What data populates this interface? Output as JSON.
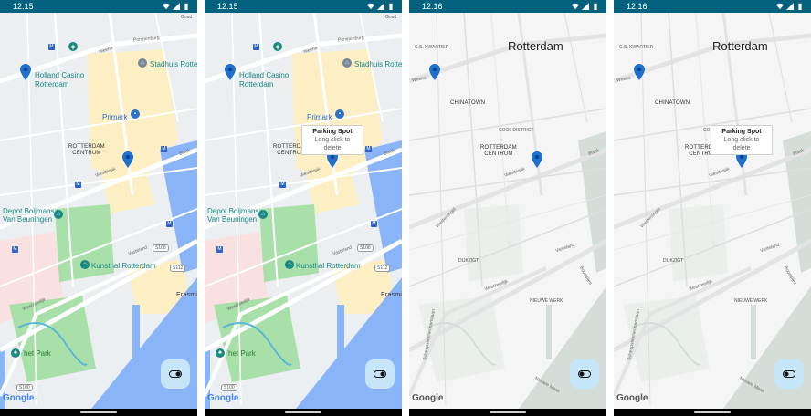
{
  "phones": [
    {
      "time": "12:15",
      "style": "normal",
      "labels": {
        "pompenburg": "Pompenburg",
        "weena": "Weena",
        "holland_casino": "Holland Casino\nRotterdam",
        "stadhuis": "Stadhuis Rotter",
        "primark": "Primark",
        "rotterdam_centrum": "ROTTERDAM\nCENTRUM",
        "westblaak": "Westblaak",
        "blaak": "Blaak",
        "depot": "Depot Boijmans\nVan Beuningen",
        "kunsthal": "Kunsthal Rotterdam",
        "vasteland": "Vasteland",
        "westzeedijk": "Westzeedijk",
        "het_park": "het Park",
        "erasmus": "Erasmi",
        "goud": "Goud",
        "shield_s108": "S108",
        "shield_s112": "S112",
        "shield_s100": "S100"
      }
    },
    {
      "time": "12:15",
      "style": "normal",
      "info_title": "Parking Spot",
      "info_snippet": "Long click to delete",
      "labels": {
        "pompenburg": "Pompenburg",
        "weena": "Weena",
        "holland_casino": "Holland Casino\nRotterdam",
        "stadhuis": "Stadhuis Rotter",
        "primark": "Primark",
        "rotterdam_centrum": "ROTTERDAM\nCENTRUM",
        "westblaak": "Westblaak",
        "blaak": "Blaak",
        "depot": "Depot Boijmans\nVan Beuningen",
        "kunsthal": "Kunsthal Rotterdam",
        "vasteland": "Vasteland",
        "westzeedijk": "Westzeedijk",
        "het_park": "het Park",
        "erasmus": "Erasmi",
        "goud": "Goud",
        "shield_s108": "S108",
        "shield_s112": "S112",
        "shield_s100": "S100"
      }
    },
    {
      "time": "12:16",
      "style": "retro",
      "labels": {
        "cs_kwartier": "C.S. KWARTIER",
        "rotterdam": "Rotterdam",
        "weena": "Weena",
        "chinatown": "CHINATOWN",
        "cool_district": "COOL DISTRICT",
        "rotterdam_centrum": "ROTTERDAM\nCENTRUM",
        "westblaak": "Westblaak",
        "blaak": "Blaak",
        "dijkzigt": "DIJKZIGT",
        "vasteland": "Vasteland",
        "westzeedijk": "Westzeedijk",
        "nieuwe_werk": "NIEUWE WERK",
        "scheepstimmermanslaan": "Scheepstimmermanslaan",
        "boompjes": "Boompjes",
        "westersingel": "Westersingel",
        "nieuwe_maas": "Nieuwe Maas"
      }
    },
    {
      "time": "12:16",
      "style": "retro",
      "info_title": "Parking Spot",
      "info_snippet": "Long click to delete",
      "labels": {
        "cs_kwartier": "C.S. KWARTIER",
        "rotterdam": "Rotterdam",
        "weena": "Weena",
        "chinatown": "CHINATOWN",
        "cool_district": "CO",
        "rotterdam_centrum": "ROTTERDAM\nCENTRUM",
        "westblaak": "Westblaak",
        "blaak": "Blaak",
        "dijkzigt": "DIJKZIGT",
        "vasteland": "Vasteland",
        "westzeedijk": "Westzeedijk",
        "nieuwe_werk": "NIEUWE WERK",
        "scheepstimmermanslaan": "Scheepstimmermanslaan",
        "boompjes": "Boompjes",
        "westersingel": "Westersingel",
        "nieuwe_maas": "Nieuwe Maas"
      }
    }
  ],
  "google_logo": "Google",
  "icons": {
    "status": [
      "wifi-icon",
      "signal-icon",
      "battery-icon"
    ],
    "fab": "toggle-switch-icon",
    "marker": "map-marker-icon"
  },
  "colors": {
    "status_bar": "#04627e",
    "marker": "#1f6fcf",
    "fab_bg": "#c6e6f7",
    "water_normal": "#8ab4f8",
    "water_retro": "#d4ddd8",
    "park": "#9ed9a4",
    "teal_label": "#1a8a83"
  }
}
